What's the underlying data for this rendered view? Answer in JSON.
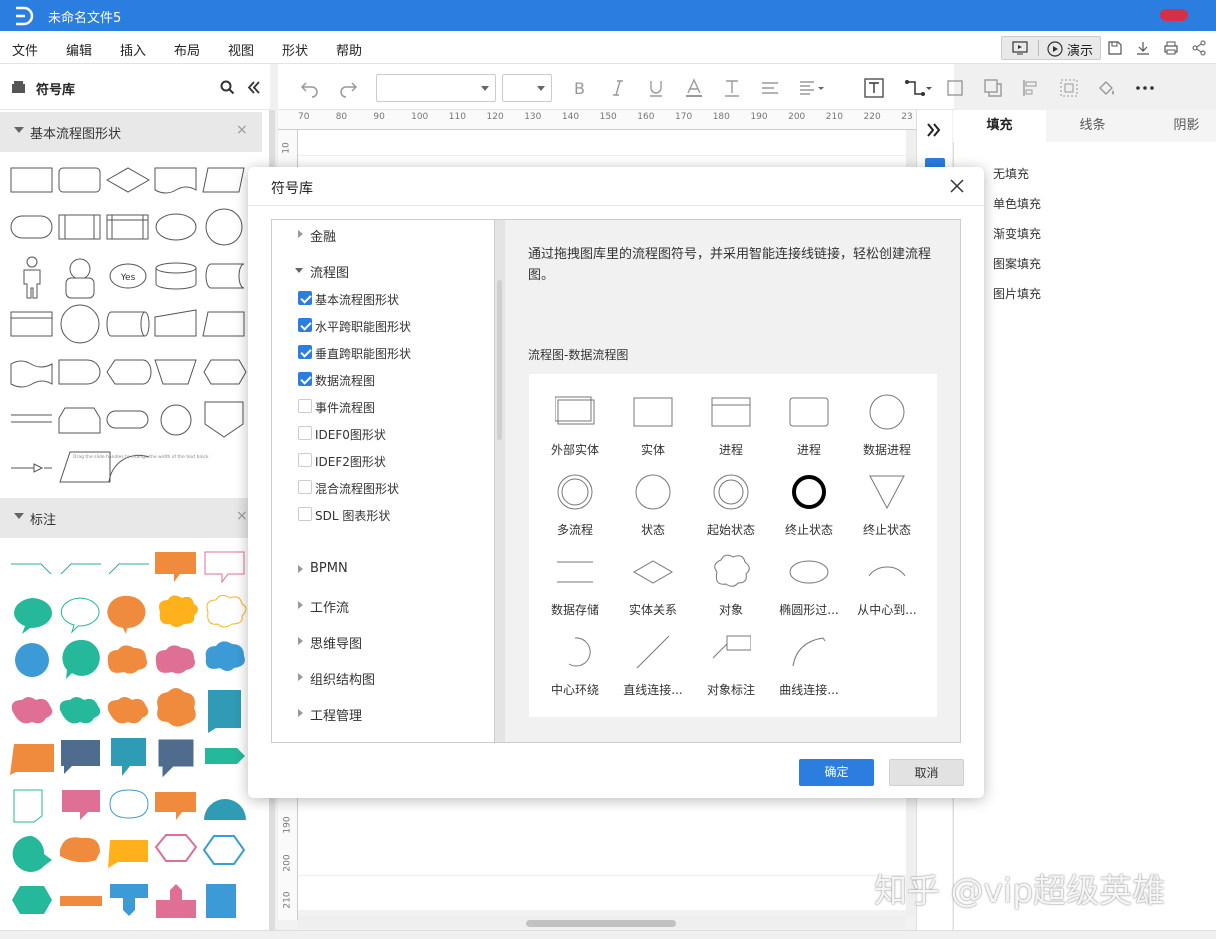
{
  "app": {
    "doc_title": "未命名文件5"
  },
  "menu": [
    "文件",
    "编辑",
    "插入",
    "布局",
    "视图",
    "形状",
    "帮助"
  ],
  "present_label": "演示",
  "sidebar": {
    "title": "符号库",
    "section1": "基本流程图形状",
    "section2": "标注",
    "close": "×",
    "mini_text": "Drag the slide handles to change the width of the text block"
  },
  "ruler": {
    "h": [
      "70",
      "80",
      "90",
      "100",
      "110",
      "120",
      "130",
      "140",
      "150",
      "160",
      "170",
      "180",
      "190",
      "200",
      "210",
      "220",
      "23"
    ],
    "v": [
      "10",
      "190",
      "200",
      "210"
    ]
  },
  "right_panel": {
    "tabs": [
      "填充",
      "线条",
      "阴影"
    ],
    "options": [
      "无填充",
      "单色填充",
      "渐变填充",
      "图案填充",
      "图片填充"
    ]
  },
  "dialog": {
    "title": "符号库",
    "tree_top": "金融",
    "tree_open": "流程图",
    "checks": [
      {
        "label": "基本流程图形状",
        "checked": true
      },
      {
        "label": "水平跨职能图形状",
        "checked": true
      },
      {
        "label": "垂直跨职能图形状",
        "checked": true
      },
      {
        "label": "数据流程图",
        "checked": true
      },
      {
        "label": "事件流程图",
        "checked": false
      },
      {
        "label": "IDEF0图形状",
        "checked": false
      },
      {
        "label": "IDEF2图形状",
        "checked": false
      },
      {
        "label": "混合流程图形状",
        "checked": false
      },
      {
        "label": "SDL 图表形状",
        "checked": false
      }
    ],
    "tree_more": [
      "BPMN",
      "工作流",
      "思维导图",
      "组织结构图",
      "工程管理"
    ],
    "description": "通过拖拽图库里的流程图符号，并采用智能连接线链接，轻松创建流程图。",
    "preview_title": "流程图-数据流程图",
    "shapes": [
      "外部实体",
      "实体",
      "进程",
      "进程",
      "数据进程",
      "多流程",
      "状态",
      "起始状态",
      "终止状态",
      "终止状态",
      "数据存储",
      "实体关系",
      "对象",
      "椭圆形过...",
      "从中心到...",
      "中心环绕",
      "直线连接...",
      "对象标注",
      "曲线连接..."
    ],
    "ok": "确定",
    "cancel": "取消"
  },
  "yes_label": "Yes",
  "watermark": "知乎 @vip超级英雄",
  "colors": {
    "accent": "#2b7de0",
    "orange": "#f08a3c",
    "teal": "#25b89a",
    "pink": "#e06f95",
    "blue": "#3c9bd6",
    "yellow": "#ffb11b",
    "navy": "#4f6b8e"
  }
}
